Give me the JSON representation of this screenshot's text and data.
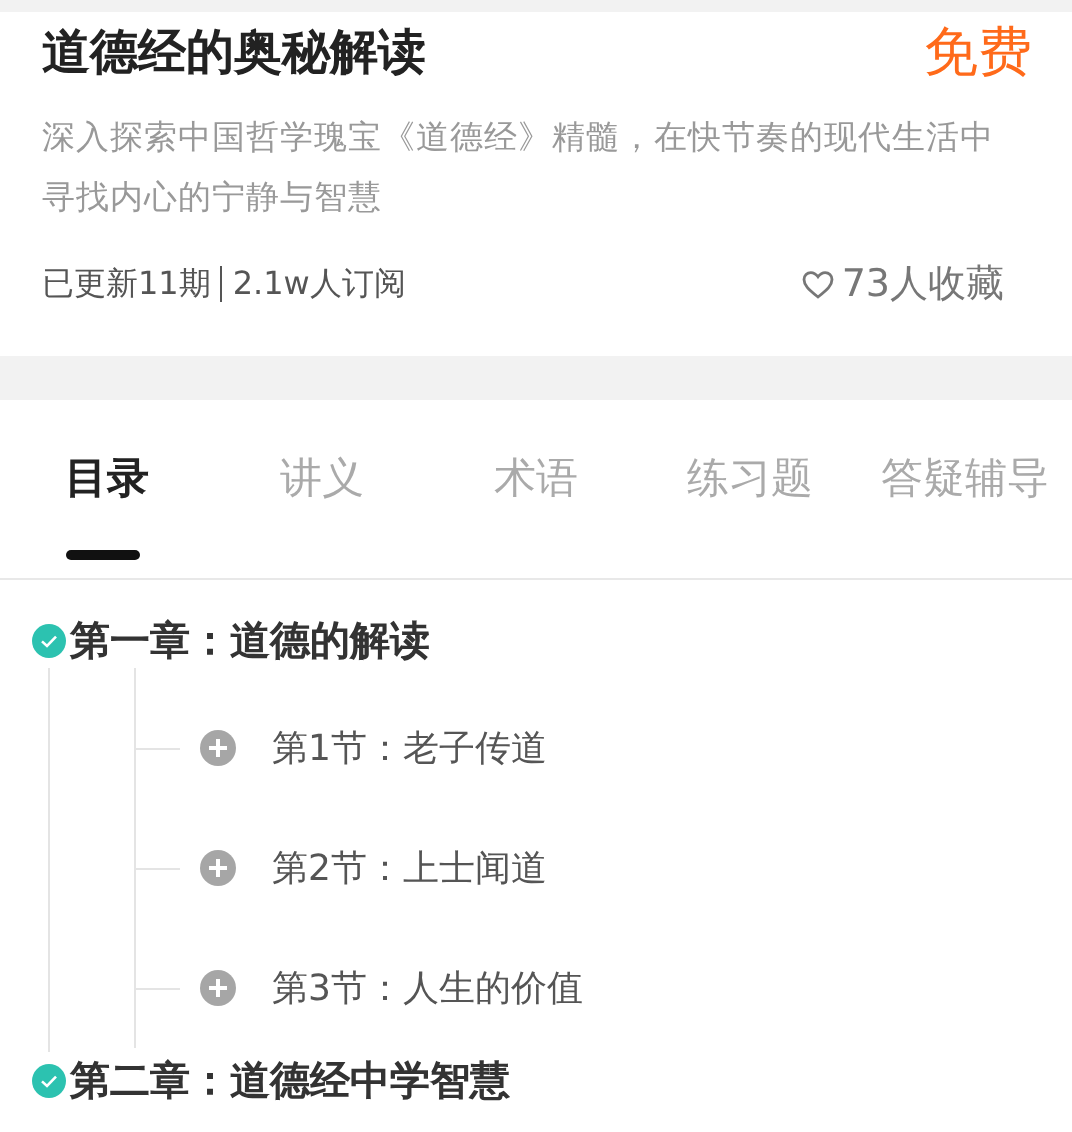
{
  "course": {
    "title": "道德经的奥秘解读",
    "price": "免费",
    "description": "深入探索中国哲学瑰宝《道德经》精髓，在快节奏的现代生活中寻找内心的宁静与智慧",
    "updates": "已更新11期",
    "subscribers": "2.1w人订阅",
    "favorites": "73人收藏"
  },
  "tabs": [
    {
      "label": "目录",
      "selected": true
    },
    {
      "label": "讲义",
      "selected": false
    },
    {
      "label": "术语",
      "selected": false
    },
    {
      "label": "练习题",
      "selected": false
    },
    {
      "label": "答疑辅导",
      "selected": false
    }
  ],
  "chapters": [
    {
      "title": "第一章：道德的解读",
      "checked": true,
      "children": [
        {
          "title": "第1节：老子传道",
          "expanded": false
        },
        {
          "title": "第2节：上士闻道",
          "expanded": false
        },
        {
          "title": "第3节：人生的价值",
          "expanded": false
        }
      ]
    },
    {
      "title": "第二章：道德经中学智慧",
      "checked": true
    }
  ]
}
